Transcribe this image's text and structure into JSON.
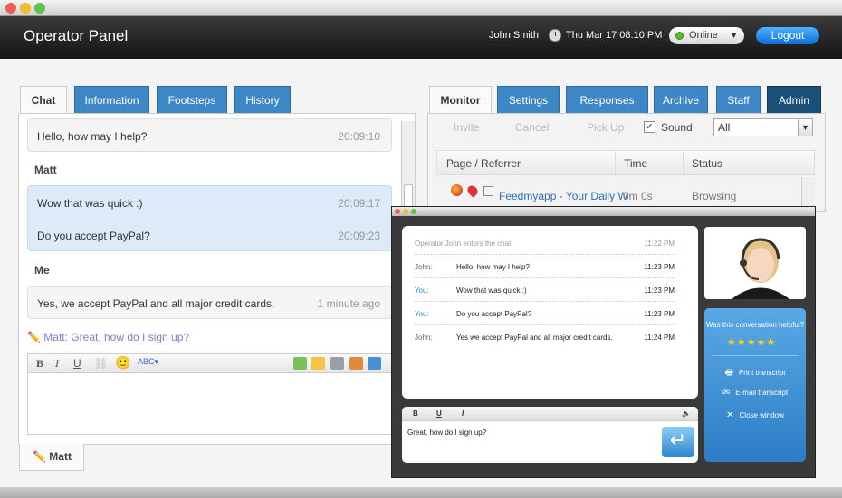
{
  "app": {
    "title": "Operator Panel",
    "user": "John Smith",
    "datetime": "Thu Mar 17 08:10 PM",
    "status": "Online",
    "logout_label": "Logout"
  },
  "left_tabs": [
    "Chat",
    "Information",
    "Footsteps",
    "History"
  ],
  "chat": {
    "messages": [
      {
        "text": "Hello, how may I help?",
        "time": "20:09:10"
      },
      {
        "text": "Wow that was quick :)",
        "time": "20:09:17"
      },
      {
        "text": "Do you accept PayPal?",
        "time": "20:09:23"
      },
      {
        "text": "Yes, we accept PayPal and all major credit cards.",
        "time": "1 minute ago"
      }
    ],
    "visitor_name": "Matt",
    "operator_name": "Me",
    "typing_name": "Matt:",
    "typing_text": "Great, how do I sign up?",
    "bottom_tab": "Matt"
  },
  "right_tabs": [
    "Monitor",
    "Settings",
    "Responses",
    "Archive",
    "Staff",
    "Admin"
  ],
  "monitor": {
    "toolbar": {
      "invite": "Invite",
      "cancel": "Cancel",
      "pickup": "Pick Up",
      "sound": "Sound",
      "filter": "All"
    },
    "columns": [
      "Page / Referrer",
      "Time",
      "Status"
    ],
    "row": {
      "page": "Feedmyapp - Your Daily W",
      "time": "0m 0s",
      "status": "Browsing"
    }
  },
  "popup": {
    "enter": {
      "text": "Operator John enters the chat",
      "time": "11:22 PM"
    },
    "lines": [
      {
        "name": "John:",
        "text": "Hello, how may I help?",
        "time": "11:23 PM"
      },
      {
        "name": "You:",
        "text": "Wow that was quick :)",
        "time": "11:23 PM"
      },
      {
        "name": "You:",
        "text": "Do you accept PayPal?",
        "time": "11:23 PM"
      },
      {
        "name": "John:",
        "text": "Yes we accept PayPal and all major credit cards.",
        "time": "11:24 PM"
      }
    ],
    "compose_text": "Great, how do I sign up?",
    "question": "Was this conversation helpful?",
    "stars": "★★★★★",
    "print": "Print transcript",
    "email": "E-mail transcript",
    "close": "Close window"
  },
  "colors": {
    "accent": "#3d87c7",
    "bubble_blue": "#ddeaf7",
    "popup_blue": "#2c7dc6"
  }
}
